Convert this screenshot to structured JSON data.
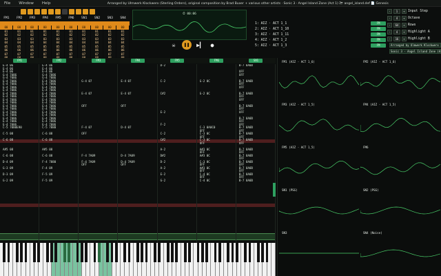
{
  "menu": {
    "items": [
      "File",
      "Window",
      "Help"
    ],
    "title": "Arranged by Ulmwerk Klockwerx (Sterling Orders), original composition by Brad Buxer + various other artists · Sonic 3 · Angel Island Zone (Act 1) 🗁 angel_island.def 📄 Genesis"
  },
  "channels": {
    "top_labels": [
      "FM1",
      "FM2",
      "FM3",
      "FM4",
      "FM5",
      "FM6",
      "SN1",
      "SN2",
      "SN3",
      "SN4"
    ],
    "grid_values": [
      [
        "00",
        "00",
        "00",
        "00",
        "00",
        "00",
        "00",
        "00",
        "00",
        "00"
      ],
      [
        "01",
        "01",
        "01",
        "01",
        "01",
        "01",
        "01",
        "01",
        "01",
        "01"
      ],
      [
        "02",
        "02",
        "02",
        "02",
        "02",
        "02",
        "02",
        "02",
        "02",
        "02"
      ],
      [
        "03",
        "03",
        "03",
        "03",
        "03",
        "03",
        "03",
        "03",
        "03",
        "03"
      ],
      [
        "04",
        "04",
        "04",
        "04",
        "04",
        "04",
        "04",
        "04",
        "04",
        "04"
      ],
      [
        "05",
        "05",
        "05",
        "05",
        "05",
        "05",
        "05",
        "05",
        "05",
        "05"
      ],
      [
        "06",
        "06",
        "06",
        "06",
        "06",
        "06",
        "06",
        "06",
        "06",
        "06"
      ],
      [
        "07",
        "07",
        "07",
        "07",
        "07",
        "07",
        "07",
        "07",
        "07",
        "07"
      ],
      [
        "08",
        "08",
        "08",
        "08",
        "08",
        "08",
        "08",
        "08",
        "08",
        "08"
      ]
    ]
  },
  "scope": {
    "time": "⏱ 00:06"
  },
  "orders": [
    {
      "label": "1: AIZ · ACT 1_1",
      "btn": "FM"
    },
    {
      "label": "2: AIZ · ACT 1_10",
      "btn": "FM"
    },
    {
      "label": "3: AIZ · ACT 1_11",
      "btn": "FM"
    },
    {
      "label": "4: AIZ · ACT 1_2",
      "btn": "FM"
    },
    {
      "label": "5: AIZ · ACT 1_3",
      "btn": "FM"
    }
  ],
  "settings": [
    {
      "value": "1",
      "label": "Input Step"
    },
    {
      "value": "4",
      "label": "Octave"
    },
    {
      "value": "64",
      "label": "Rows"
    },
    {
      "value": "4",
      "label": "Highlight A"
    },
    {
      "value": "16",
      "label": "Highlight B"
    }
  ],
  "info": {
    "arranger": "Arranged by Ulmwerk Klockwerx",
    "song": "Sonic 3 · Angel Island Zone (Act 1)"
  },
  "pattern_headers": [
    "FM1",
    "FM2",
    "FM3",
    "FM4",
    "FM5",
    "FM6",
    "SN1"
  ],
  "pattern_cols": [
    [
      "E-4 06",
      "E-4 06",
      "E-4 06",
      "G-4 7086",
      "G-4 7086",
      "E-4 7086",
      "E-4 7086",
      "E-4 7086",
      "E-4 7086",
      "E-4 7086",
      "E-4 7086",
      "E-4 7086",
      "E-4 7086",
      "E-4 7086",
      "E-4 7086",
      "E-4 7086",
      "E-4 7086",
      "E-4 7086",
      "E-4 7086",
      "E-4 7086",
      "C-5 7080E90",
      "",
      "C-5 08",
      "",
      "C-6 08",
      "",
      "",
      "A#5 08",
      "",
      "C-6 08",
      "",
      "D-4 09",
      "",
      "G-3 09",
      "",
      "D-3 09",
      "",
      "G-2 09"
    ],
    [
      "E-4 06",
      "E-4 06",
      "E-4 06",
      "G-4 7086",
      "G-4 7086",
      "E-4 7086",
      "E-4 7086",
      "E-4 7086",
      "E-4 7086",
      "E-4 7086",
      "E-4 7086",
      "E-4 7086",
      "E-4 7086",
      "E-4 7086",
      "E-4 7086",
      "E-4 7086",
      "E-4 7086",
      "E-4 7086",
      "E-4 7086",
      "E-4 7086",
      "C-5 7080",
      "",
      "C-6 08",
      "",
      "C-6 08",
      "",
      "",
      "A#5 08",
      "",
      "C-6 08",
      "",
      "F-4 7080",
      "",
      "F-4 09",
      "",
      "F-5 09",
      "",
      "F-5 09"
    ],
    [
      "",
      "",
      "",
      "",
      "",
      "G-4 07",
      "",
      "",
      "",
      "E-4 07",
      "",
      "",
      "",
      "OFF",
      "",
      "",
      "",
      "",
      "",
      "",
      "F-4 07",
      "",
      "OFF",
      "",
      "",
      "",
      "",
      "",
      "",
      "F-4 7A09",
      "",
      "F-4 7A09",
      "OFF",
      "",
      "",
      "",
      "",
      ""
    ],
    [
      "",
      "",
      "",
      "",
      "",
      "E-4 07",
      "",
      "",
      "",
      "E-4 07",
      "",
      "",
      "",
      "OFF",
      "",
      "",
      "",
      "",
      "",
      "",
      "D-4 07",
      "",
      "",
      "",
      "",
      "",
      "",
      "",
      "",
      "D-4 7A09",
      "",
      "D-4 7A09",
      "OFF",
      "",
      "",
      "",
      "",
      ""
    ],
    [
      "D-2",
      "",
      "",
      "",
      "",
      "C-2",
      "",
      "",
      "",
      "C#2",
      "",
      "",
      "",
      "",
      "",
      "E-2",
      "",
      "",
      "",
      "F-2",
      "",
      "",
      "C-2",
      "",
      "C#2",
      "",
      "",
      "A-2",
      "",
      "D#2",
      "",
      "D-2",
      "",
      "A-2",
      "",
      "E-2",
      "",
      "G-2"
    ],
    [
      "",
      "",
      "",
      "",
      "",
      "G-2 0C",
      "",
      "",
      "",
      "G-2 0C",
      "",
      "",
      "",
      "",
      "",
      "",
      "",
      "",
      "",
      "",
      "C-3 0A0C0",
      "OFF",
      "C-3 0C",
      "OFF",
      "C-3 0C",
      "OFF",
      "",
      "A#3 0C",
      "OFF",
      "A#3 0C",
      "",
      "C-3 0C",
      "OFF",
      "A#3 0C",
      "OFF",
      "C-4 0C",
      "OFF",
      "C-4 0C"
    ],
    [
      "B-7 0A0D",
      "",
      "OFF",
      "OFF",
      "",
      "B-7 0A0D",
      "OFF",
      "OFF",
      "",
      "B-7 0A0D",
      "OFF",
      "OFF",
      "",
      "B-7 0A0D",
      "OFF",
      "OFF",
      "",
      "B-7 0A0D",
      "OFF",
      "OFF",
      "B-7 0A0D",
      "OFF",
      "B-7 0A0D",
      "OFF",
      "B-7 0A0D",
      "OFF",
      "",
      "B-7 0A0D",
      "OFF",
      "B-7 0A0D",
      "OFF",
      "B-7 0A0D",
      "OFF",
      "B-7 0A0D",
      "OFF",
      "B-7 0A0D",
      "OFF",
      "B-7 0A0D"
    ]
  ],
  "scopes": [
    {
      "title": "FM1 (AIZ · ACT 1_6)"
    },
    {
      "title": "FM2 (AIZ · ACT 1_6)"
    },
    {
      "title": "FM3 (AIZ · ACT 1_5)"
    },
    {
      "title": "FM4 (AIZ · ACT 1_5)"
    },
    {
      "title": "FM5 (AIZ · ACT 1_5)"
    },
    {
      "title": "FM6"
    },
    {
      "title": "SN1 (PSG)"
    },
    {
      "title": "SN2 (PSG)"
    },
    {
      "title": "SN3"
    },
    {
      "title": "SN4 (Noise)"
    }
  ]
}
